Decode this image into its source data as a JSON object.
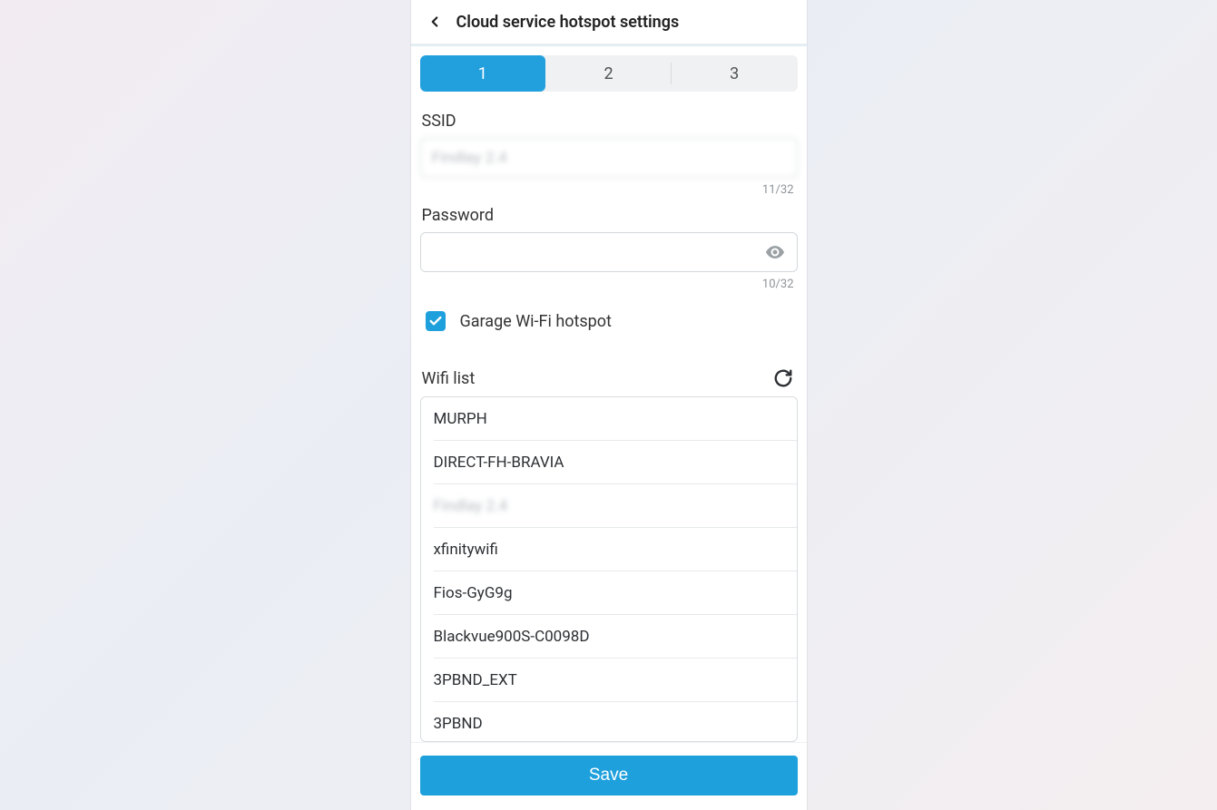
{
  "header": {
    "title": "Cloud service hotspot settings"
  },
  "steps": {
    "items": [
      "1",
      "2",
      "3"
    ],
    "active_index": 0
  },
  "ssid": {
    "label": "SSID",
    "value": "Findlay 2.4",
    "counter": "11/32"
  },
  "password": {
    "label": "Password",
    "value": "",
    "counter": "10/32"
  },
  "garage_checkbox": {
    "checked": true,
    "label": "Garage Wi-Fi hotspot"
  },
  "wifi_list": {
    "title": "Wifi list",
    "items": [
      {
        "name": "MURPH",
        "blurred": false
      },
      {
        "name": "DIRECT-FH-BRAVIA",
        "blurred": false
      },
      {
        "name": "Findlay 2.4",
        "blurred": true
      },
      {
        "name": "xfinitywifi",
        "blurred": false
      },
      {
        "name": "Fios-GyG9g",
        "blurred": false
      },
      {
        "name": "Blackvue900S-C0098D",
        "blurred": false
      },
      {
        "name": "3PBND_EXT",
        "blurred": false
      },
      {
        "name": "3PBND",
        "blurred": false
      }
    ]
  },
  "footer": {
    "save_label": "Save"
  }
}
